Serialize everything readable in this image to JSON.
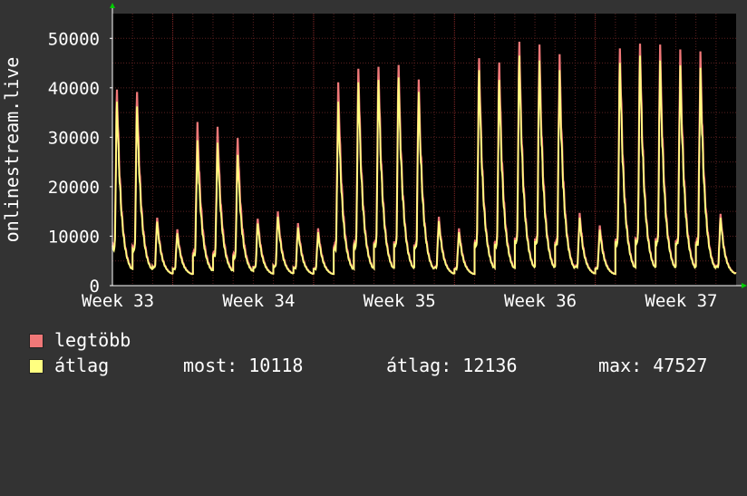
{
  "chart_data": {
    "type": "line",
    "ylabel": "onlinestream.live",
    "ylim": [
      0,
      55000
    ],
    "yticks": [
      0,
      10000,
      20000,
      30000,
      40000,
      50000
    ],
    "grid": true,
    "week_labels": [
      "Week 33",
      "Week 34",
      "Week 35",
      "Week 36",
      "Week 37"
    ],
    "colors": {
      "max": "#f07878",
      "avg": "#ffff80",
      "background": "#000000",
      "grid": "#5a2020",
      "axis": "#ffffff"
    },
    "series": [
      {
        "name": "legtöbb",
        "daily_peaks": [
          40500,
          40000,
          14000,
          11600,
          33800,
          32800,
          30500,
          13800,
          15300,
          12900,
          11800,
          42000,
          44800,
          45200,
          45600,
          42600,
          14200,
          11800,
          47000,
          46100,
          50400,
          49800,
          47800,
          15000,
          12400,
          49000,
          50000,
          49800,
          48800,
          48400,
          14800
        ]
      },
      {
        "name": "átlag",
        "daily_peaks": [
          38000,
          37000,
          13200,
          10800,
          30000,
          29500,
          27000,
          12800,
          14200,
          12000,
          11000,
          38000,
          42000,
          42500,
          43000,
          40000,
          13300,
          11000,
          44500,
          42500,
          47500,
          46500,
          44500,
          14000,
          11500,
          46000,
          47500,
          46500,
          45500,
          45000,
          14000
        ]
      }
    ],
    "gap_after_day": 15
  },
  "legend": {
    "max_label": "legtöbb",
    "avg_label": "átlag",
    "stats": [
      {
        "label": "most: 10118"
      },
      {
        "label": "átlag: 12136"
      },
      {
        "label": "max: 47527"
      }
    ]
  }
}
